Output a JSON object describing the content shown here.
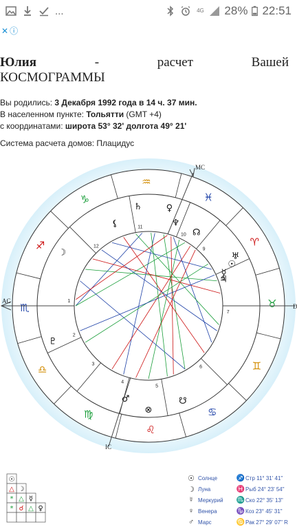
{
  "status_bar": {
    "network": "4G",
    "battery": "28%",
    "time": "22:51",
    "menu": "..."
  },
  "ad_bar": {
    "close": "✕",
    "info": "ⓘ"
  },
  "title": {
    "name": "Юлия",
    "dash": "-",
    "w1": "расчет",
    "w2": "Вашей",
    "line2": "КОСМОГРАММЫ"
  },
  "info": {
    "born_prefix": "Вы родились:",
    "born_value": "3 Декабря 1992 года в 14 ч. 37 мин.",
    "place_prefix": "В населенном пункте:",
    "place_value": "Тольятти",
    "place_tz": "(GMT +4)",
    "coords_prefix": "с координатами:",
    "coords_value": "широта 53° 32' долгота 49° 21'",
    "system": "Система расчета домов: Плацидус"
  },
  "chart": {
    "labels": {
      "mc": "MC",
      "ic": "IC",
      "ac": "AC",
      "dc": "D"
    },
    "zodiac": [
      {
        "glyph": "♒",
        "name": "aquarius",
        "color": "#d28b00"
      },
      {
        "glyph": "♑",
        "name": "capricorn",
        "color": "#1a9e3a"
      },
      {
        "glyph": "♐",
        "name": "sagittarius",
        "color": "#cc1111"
      },
      {
        "glyph": "♏",
        "name": "scorpio",
        "color": "#1b3fa6"
      },
      {
        "glyph": "♎",
        "name": "libra",
        "color": "#d28b00"
      },
      {
        "glyph": "♍",
        "name": "virgo",
        "color": "#1a9e3a"
      },
      {
        "glyph": "♌",
        "name": "leo",
        "color": "#cc1111"
      },
      {
        "glyph": "♋",
        "name": "cancer",
        "color": "#1b3fa6"
      },
      {
        "glyph": "♊",
        "name": "gemini",
        "color": "#d28b00"
      },
      {
        "glyph": "♉",
        "name": "taurus",
        "color": "#1a9e3a"
      },
      {
        "glyph": "♈",
        "name": "aries",
        "color": "#cc1111"
      },
      {
        "glyph": "♓",
        "name": "pisces",
        "color": "#1b3fa6"
      }
    ],
    "houses": [
      "1",
      "2",
      "3",
      "4",
      "5",
      "6",
      "7",
      "8",
      "9",
      "10",
      "11",
      "12"
    ],
    "planets": [
      {
        "glyph": "♄",
        "name": "saturn"
      },
      {
        "glyph": "♀",
        "name": "venus"
      },
      {
        "glyph": "♆",
        "name": "neptune"
      },
      {
        "glyph": "☊",
        "name": "node"
      },
      {
        "glyph": "⚸",
        "name": "lilith"
      },
      {
        "glyph": "☽",
        "name": "moon"
      },
      {
        "glyph": "♅",
        "name": "uranus"
      },
      {
        "glyph": "☿",
        "name": "mercury"
      },
      {
        "glyph": "☉",
        "name": "sun"
      },
      {
        "glyph": "♇",
        "name": "pluto"
      },
      {
        "glyph": "♂",
        "name": "mars"
      },
      {
        "glyph": "⊗",
        "name": "fortune"
      },
      {
        "glyph": "☋",
        "name": "south-node"
      },
      {
        "glyph": "♃",
        "name": "jupiter"
      }
    ]
  },
  "aspect_grid": {
    "planets": [
      "☉",
      "☽",
      "☿",
      "♀"
    ],
    "cells": [
      "△",
      "*",
      "△",
      "*",
      "☌",
      "△",
      "*",
      "☍",
      "*"
    ]
  },
  "legend": [
    {
      "glyph": "☉",
      "name": "Солнце",
      "sign": "♐",
      "pos": "Стр 11° 31' 41\""
    },
    {
      "glyph": "☽",
      "name": "Луна",
      "sign": "♓",
      "pos": "Рыб 24° 23' 54\""
    },
    {
      "glyph": "☿",
      "name": "Меркурий",
      "sign": "♏",
      "pos": "Ско 22° 35' 13\""
    },
    {
      "glyph": "♀",
      "name": "Венера",
      "sign": "♑",
      "pos": "Коз 23° 45' 31\""
    },
    {
      "glyph": "♂",
      "name": "Марс",
      "sign": "♋",
      "pos": "Рак 27° 29' 07\" R"
    }
  ]
}
